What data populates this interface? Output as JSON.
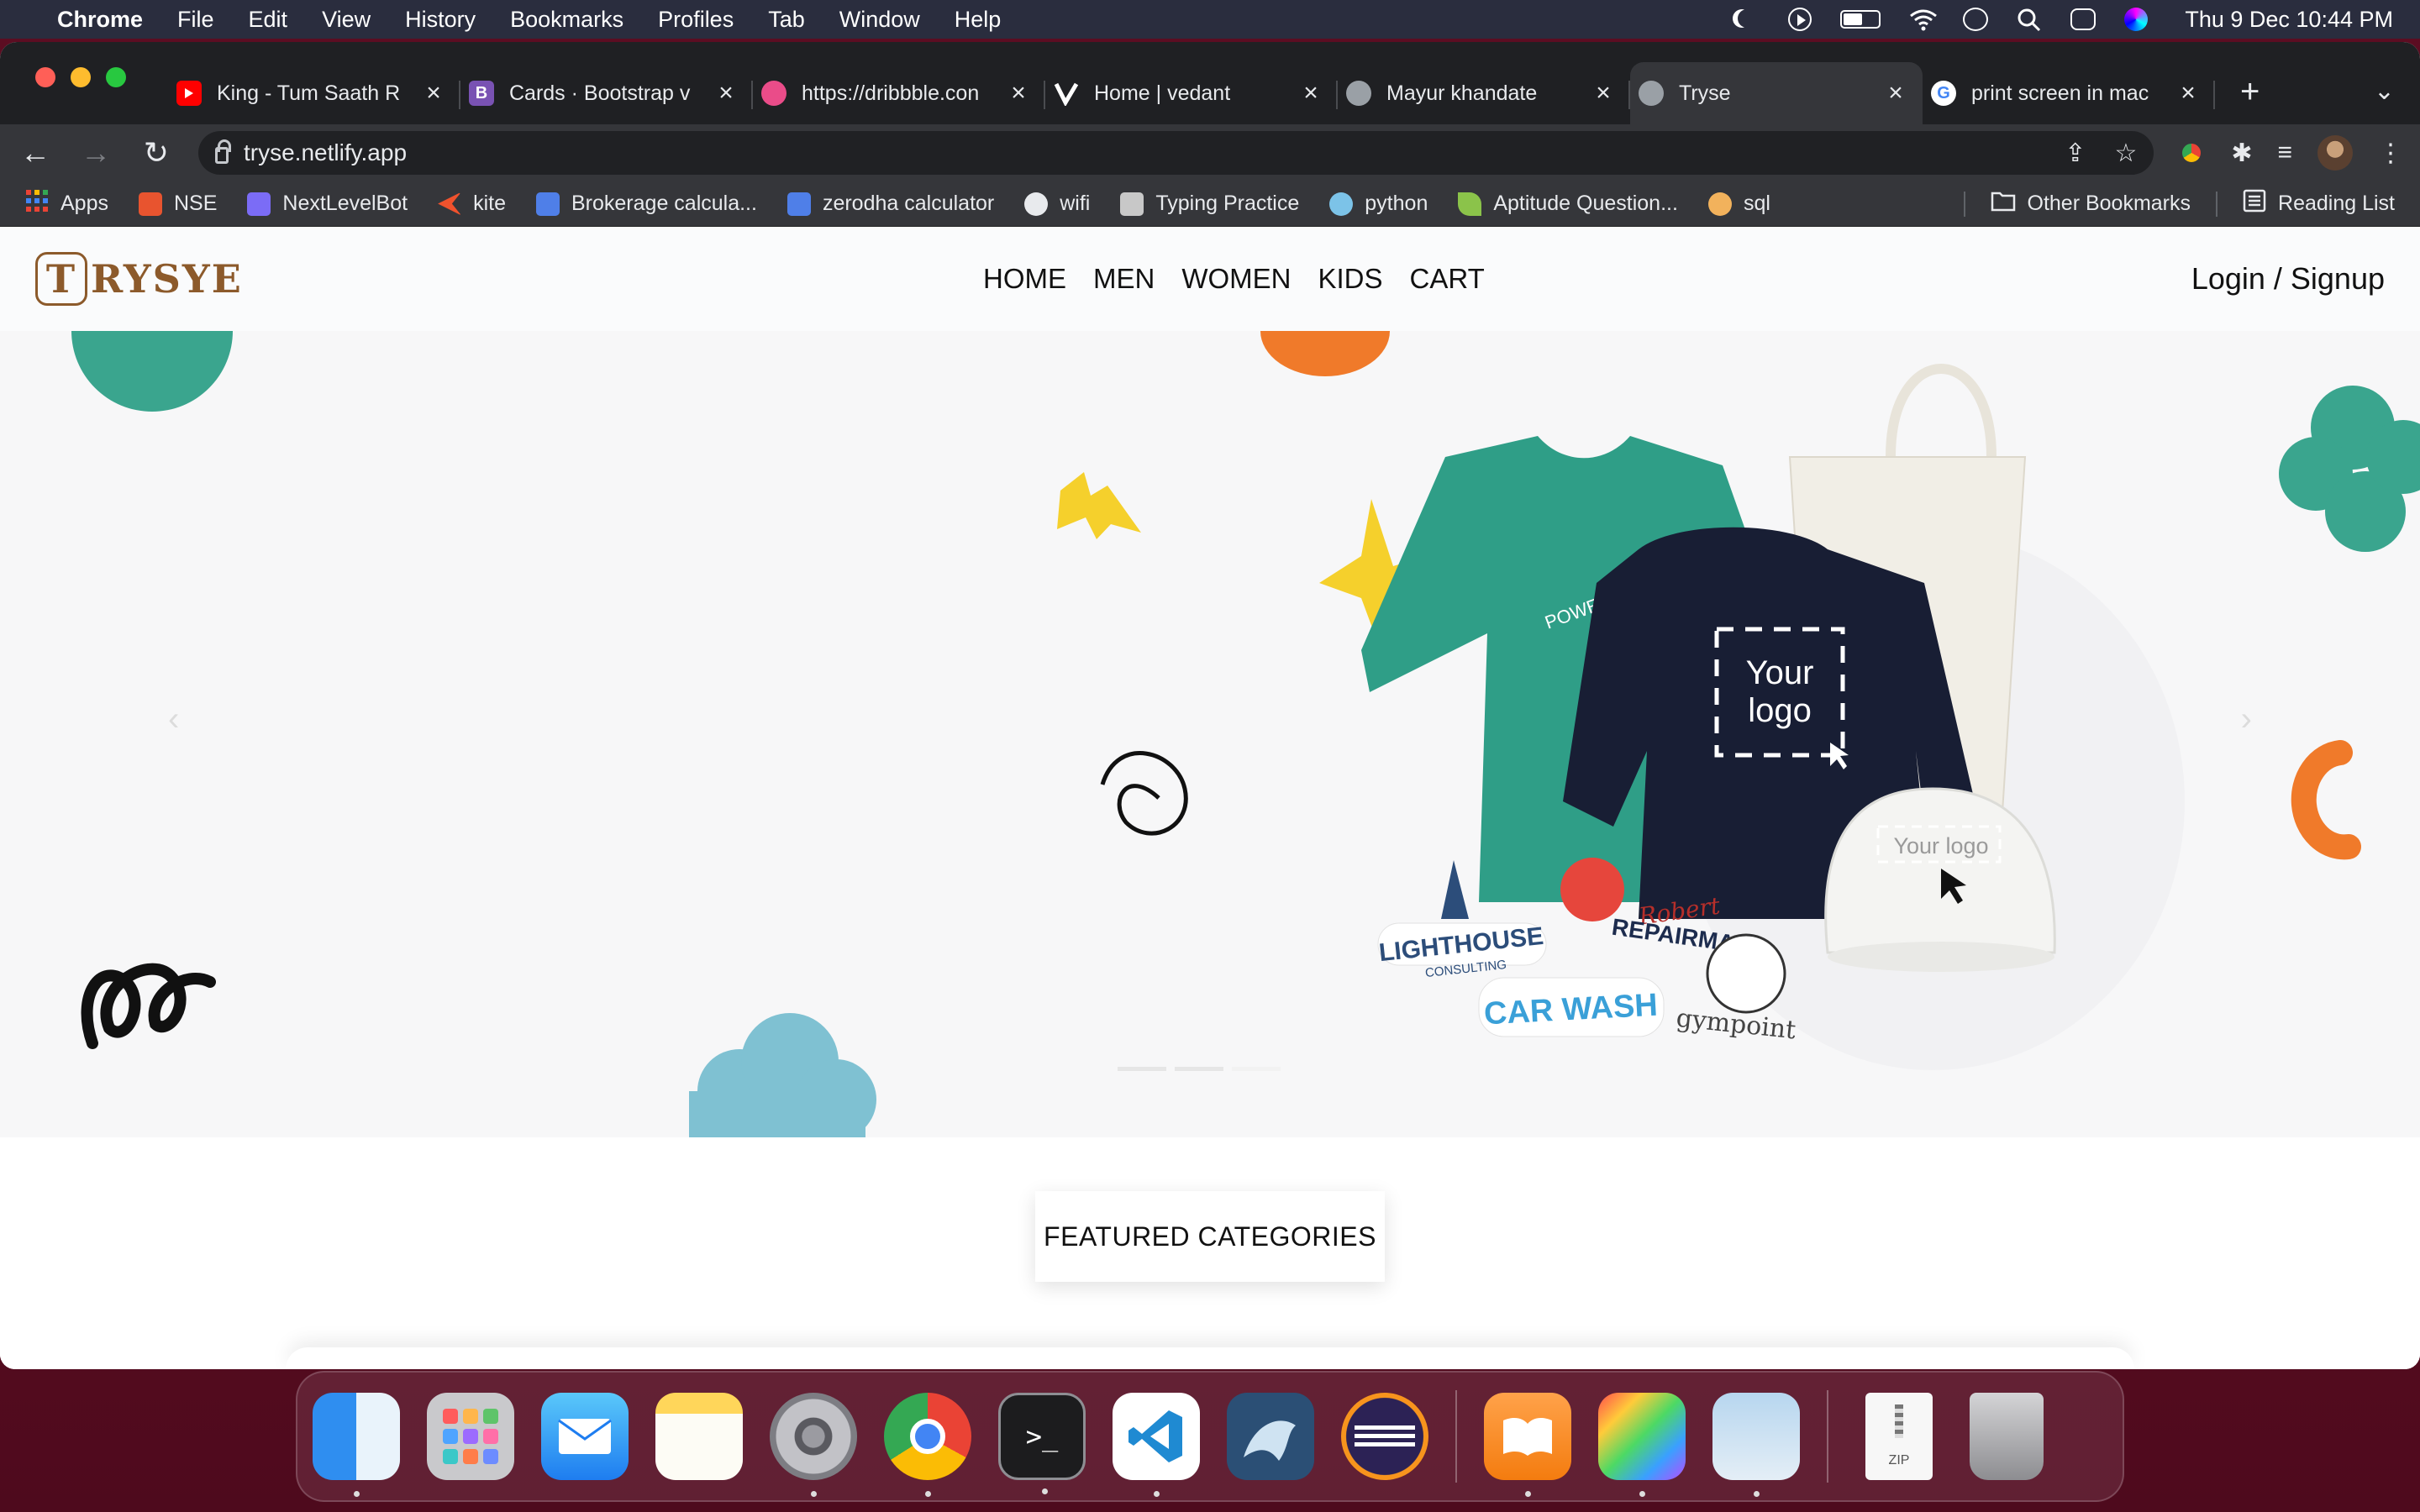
{
  "menubar": {
    "app_name": "Chrome",
    "items": [
      "File",
      "Edit",
      "View",
      "History",
      "Bookmarks",
      "Profiles",
      "Tab",
      "Window",
      "Help"
    ],
    "clock": "Thu 9 Dec  10:44 PM"
  },
  "tabs": [
    {
      "title": "King - Tum Saath R",
      "favicon_color": "#ff0000",
      "icon": "youtube-icon"
    },
    {
      "title": "Cards · Bootstrap v",
      "favicon_color": "#7952b3",
      "icon": "bootstrap-icon",
      "glyph": "B"
    },
    {
      "title": "https://dribbble.con",
      "favicon_color": "#ea4c89",
      "icon": "dribbble-icon"
    },
    {
      "title": "Home | vedant",
      "favicon_color": "#111111",
      "icon": "vercel-icon"
    },
    {
      "title": "Mayur khandate",
      "favicon_color": "#9aa0a6",
      "icon": "globe-icon"
    },
    {
      "title": "Tryse",
      "favicon_color": "#9aa0a6",
      "icon": "globe-icon",
      "active": true
    },
    {
      "title": "print screen in mac",
      "favicon_color": "#ffffff",
      "icon": "google-icon",
      "glyph": "G"
    }
  ],
  "url": "tryse.netlify.app",
  "bookmarks": [
    {
      "label": "Apps",
      "color": "#ea4335",
      "icon": "apps-grid-icon"
    },
    {
      "label": "NSE",
      "color": "#e8542f",
      "icon": "nse-icon"
    },
    {
      "label": "NextLevelBot",
      "color": "#7b6cf6",
      "icon": "nextlevelbot-icon"
    },
    {
      "label": "kite",
      "color": "#f0522d",
      "icon": "kite-icon"
    },
    {
      "label": "Brokerage calcula...",
      "color": "#4f7fe8",
      "icon": "bookmark-page-icon"
    },
    {
      "label": "zerodha calculator",
      "color": "#4f7fe8",
      "icon": "bookmark-page-icon"
    },
    {
      "label": "wifi",
      "color": "#e8eaed",
      "icon": "globe-icon"
    },
    {
      "label": "Typing Practice",
      "color": "#c8c8c8",
      "icon": "typing-icon"
    },
    {
      "label": "python",
      "color": "#7cc3e8",
      "icon": "python-icon"
    },
    {
      "label": "Aptitude Question...",
      "color": "#8bc34a",
      "icon": "leaf-icon"
    },
    {
      "label": "sql",
      "color": "#f2b25c",
      "icon": "sql-icon"
    }
  ],
  "bookmarks_right": [
    "Other Bookmarks",
    "Reading List"
  ],
  "site": {
    "logo_letter": "T",
    "logo_rest": "RYSYE",
    "nav": [
      "HOME",
      "MEN",
      "WOMEN",
      "KIDS",
      "CART"
    ],
    "login": "Login / Signup",
    "hero": {
      "shirt_print": "POWER",
      "sweater_logo_line1": "Your",
      "sweater_logo_line2": "logo",
      "cap_logo": "Your logo",
      "stickers": [
        "LIGHTHOUSE",
        "CONSULTING",
        "Robert",
        "REPAIRMAN",
        "CAR WASH",
        "gympoint"
      ]
    },
    "featured": "FEATURED CATEGORIES"
  },
  "colors": {
    "brand": "#8c5a2b",
    "teal": "#3aa58e",
    "orange": "#f07a2a",
    "yellow": "#f5d02c",
    "blue_cloud": "#7fc1d2",
    "tab_active": "#35363a",
    "tabstrip": "#1f2023"
  },
  "dock": [
    {
      "name": "finder",
      "icon": "finder-icon"
    },
    {
      "name": "launchpad",
      "icon": "launchpad-icon"
    },
    {
      "name": "mail",
      "icon": "mail-icon"
    },
    {
      "name": "notes",
      "icon": "notes-icon"
    },
    {
      "name": "system preferences",
      "icon": "settings-gear-icon"
    },
    {
      "name": "chrome",
      "icon": "chrome-icon"
    },
    {
      "name": "terminal",
      "icon": "terminal-icon"
    },
    {
      "name": "vscode",
      "icon": "vscode-icon"
    },
    {
      "name": "mysql workbench",
      "icon": "mysql-icon"
    },
    {
      "name": "eclipse",
      "icon": "eclipse-icon"
    },
    {
      "name": "books",
      "icon": "books-icon"
    },
    {
      "name": "colorsync",
      "icon": "colorsync-icon"
    },
    {
      "name": "preview",
      "icon": "preview-icon"
    },
    {
      "name": "zip archive",
      "icon": "zip-icon",
      "label": "ZIP"
    },
    {
      "name": "trash",
      "icon": "trash-icon"
    }
  ]
}
